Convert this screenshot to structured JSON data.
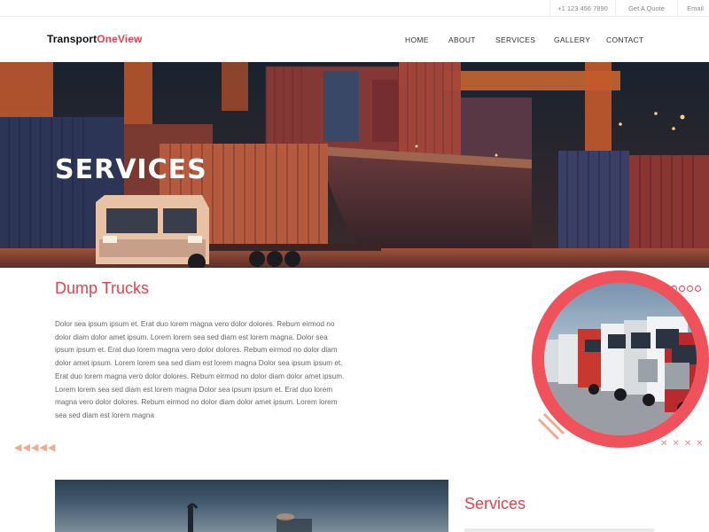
{
  "topbar": {
    "phone": "+1 123 456 7890",
    "quote": "Get A Quote",
    "email": "Email"
  },
  "logo": {
    "part1": "Transport",
    "part2": "OneView"
  },
  "nav": {
    "home": "HOME",
    "about": "ABOUT",
    "services": "SERVICES",
    "gallery": "GALLERY",
    "contact": "CONTACT"
  },
  "hero": {
    "title": "SERVICES"
  },
  "content": {
    "title": "Dump Trucks",
    "body": "Dolor sea ipsum ipsum et. Erat duo lorem magna vero dolor dolores. Rebum eirmod no dolor diam dolor amet ipsum. Lorem lorem sea sed diam est lorem magna. Dolor sea ipsum ipsum et. Erat duo lorem magna vero dolor dolores. Rebum eirmod no dolor diam dolor amet ipsum. Lorem lorem sea sed diam est lorem magna Dolor sea ipsum ipsum et. Erat duo lorem magna vero dolor dolores. Rebum eirmod no dolor diam dolor amet ipsum. Lorem lorem sea sed diam est lorem magna Dolor sea ipsum ipsum et. Erat duo lorem magna vero dolor dolores. Rebum eirmod no dolor diam dolor amet ipsum. Lorem lorem sea sed diam est lorem magna"
  },
  "sidebar": {
    "title": "Services"
  },
  "colors": {
    "accent": "#e8424f",
    "peach": "#f2a98e"
  },
  "icons": {
    "arrows": "arrow-left-icon",
    "dots": "circle-icon",
    "crosses": "cross-icon"
  }
}
